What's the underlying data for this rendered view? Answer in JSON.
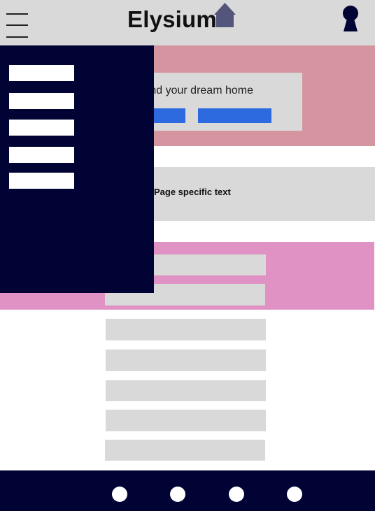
{
  "header": {
    "brand": "Elysium",
    "menu_icon": "hamburger-menu-icon",
    "house_icon": "house-icon",
    "user_icon": "user-keyhole-icon"
  },
  "hero": {
    "tagline": "Find your dream home"
  },
  "section": {
    "text": "Page specific text"
  },
  "drawer": {
    "item_count": 5
  },
  "footer": {
    "dot_count": 4
  },
  "colors": {
    "header_bg": "#d9d9d9",
    "hero_bg": "#d495a0",
    "band_bg": "#e192c4",
    "navy": "#000333",
    "accent_blue": "#2d6ae0",
    "placeholder_gray": "#d9d9d9"
  }
}
